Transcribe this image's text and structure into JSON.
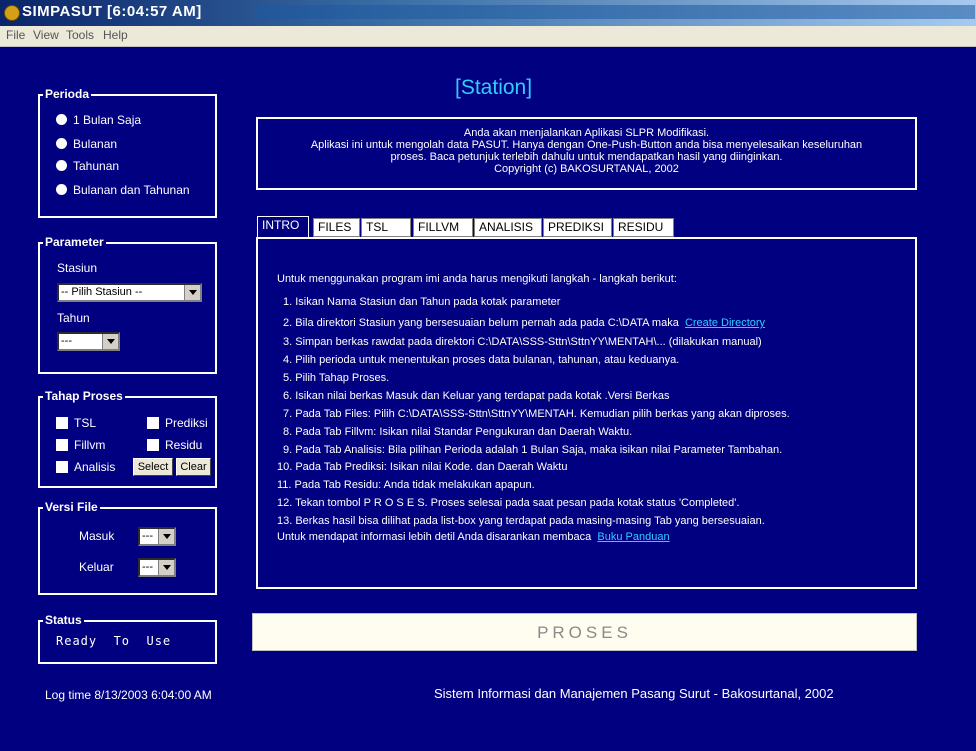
{
  "window": {
    "title": "SIMPASUT [6:04:57 AM]"
  },
  "menu": [
    "File",
    "View",
    "Tools",
    "Help"
  ],
  "perioda": {
    "label": "Perioda",
    "options": [
      "1 Bulan Saja",
      "Bulanan",
      "Tahunan",
      "Bulanan dan Tahunan"
    ]
  },
  "parameter": {
    "label": "Parameter",
    "stasiun_label": "Stasiun",
    "stasiun_value": "-- Pilih Stasiun --",
    "tahun_label": "Tahun",
    "tahun_value": "---"
  },
  "tahap": {
    "label": "Tahap Proses",
    "items": [
      "TSL",
      "Prediksi",
      "Fillvm",
      "Residu",
      "Analisis"
    ],
    "select_btn": "Select",
    "clear_btn": "Clear"
  },
  "versi": {
    "label": "Versi File",
    "masuk_label": "Masuk",
    "masuk_value": "---",
    "keluar_label": "Keluar",
    "keluar_value": "---"
  },
  "status": {
    "label": "Status",
    "text": "Ready  To  Use"
  },
  "heading": "[Station]",
  "info": [
    "Anda akan menjalankan Aplikasi SLPR Modifikasi.",
    "Aplikasi ini untuk mengolah data PASUT. Hanya dengan One-Push-Button anda bisa menyelesaikan keseluruhan",
    "proses. Baca petunjuk terlebih dahulu  untuk mendapatkan hasil yang diinginkan.",
    "Copyright (c) BAKOSURTANAL, 2002"
  ],
  "tabs": [
    "INTRO",
    "FILES",
    "TSL",
    "FILLVM",
    "ANALISIS",
    "PREDIKSI",
    "RESIDU"
  ],
  "intro": {
    "lead": "Untuk menggunakan program imi anda harus mengikuti langkah - langkah berikut:",
    "steps": [
      "1. Isikan Nama Stasiun dan Tahun pada kotak parameter",
      "2. Bila direktori Stasiun yang bersesuaian belum pernah ada pada C:\\DATA maka",
      "3. Simpan berkas rawdat pada direktori C:\\DATA\\SSS-Sttn\\SttnYY\\MENTAH\\... (dilakukan manual)",
      "4. Pilih perioda untuk menentukan proses data bulanan, tahunan, atau keduanya.",
      "5. Pilih Tahap Proses.",
      "6. Isikan nilai berkas Masuk dan Keluar yang terdapat pada kotak .Versi Berkas",
      "7. Pada Tab Files: Pilih C:\\DATA\\SSS-Sttn\\SttnYY\\MENTAH. Kemudian pilih berkas  yang akan diproses.",
      "8. Pada Tab Fillvm: Isikan nilai Standar Pengukuran dan Daerah Waktu.",
      "9. Pada Tab Analisis: Bila pilihan Perioda adalah 1 Bulan Saja, maka isikan nilai Parameter Tambahan.",
      "10. Pada Tab Prediksi: Isikan nilai Kode. dan Daerah Waktu",
      "11. Pada Tab Residu: Anda tidak melakukan apapun.",
      "12. Tekan tombol  P R O S E S. Proses selesai pada saat pesan pada kotak status 'Completed'.",
      "13. Berkas hasil bisa dilihat pada list-box yang terdapat pada masing-masing Tab yang bersesuaian."
    ],
    "create_dir_link": "Create Directory",
    "closing": "Untuk mendapat informasi lebih detil Anda disarankan membaca",
    "manual_link": "Buku Panduan"
  },
  "proses_button": "PROSES",
  "log_time": "Log time 8/13/2003 6:04:00 AM",
  "footer_credit": "Sistem Informasi  dan Manajemen Pasang Surut - Bakosurtanal, 2002"
}
